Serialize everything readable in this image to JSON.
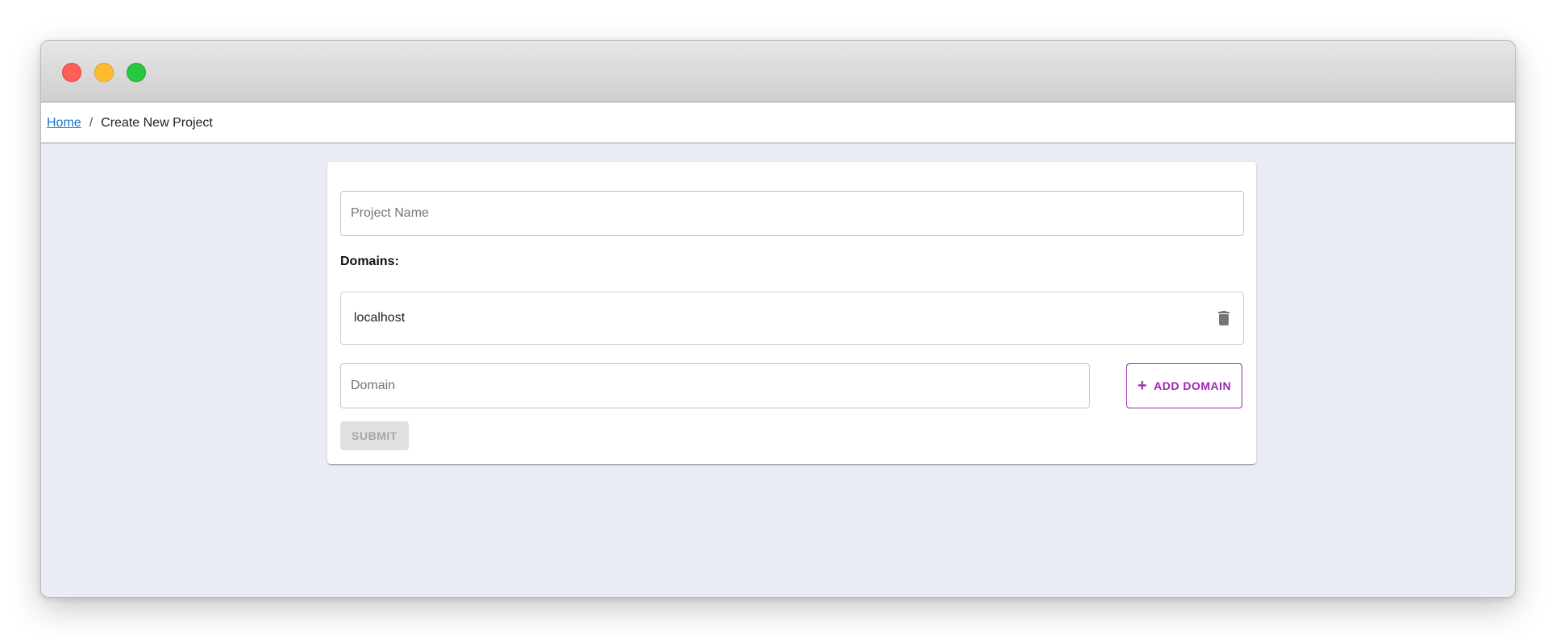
{
  "breadcrumb": {
    "home": "Home",
    "separator": "/",
    "current": "Create New Project"
  },
  "form": {
    "project_name_placeholder": "Project Name",
    "project_name_value": "",
    "domains_label": "Domains:",
    "domains": [
      {
        "name": "localhost",
        "action_icon": "trash-icon"
      }
    ],
    "domain_placeholder": "Domain",
    "domain_value": "",
    "add_domain_label": "ADD DOMAIN",
    "add_domain_icon": "plus-icon",
    "submit_label": "SUBMIT",
    "submit_disabled": true
  },
  "colors": {
    "accent": "#9c27b0",
    "link": "#1976d2",
    "background": "#e9ecf2"
  }
}
